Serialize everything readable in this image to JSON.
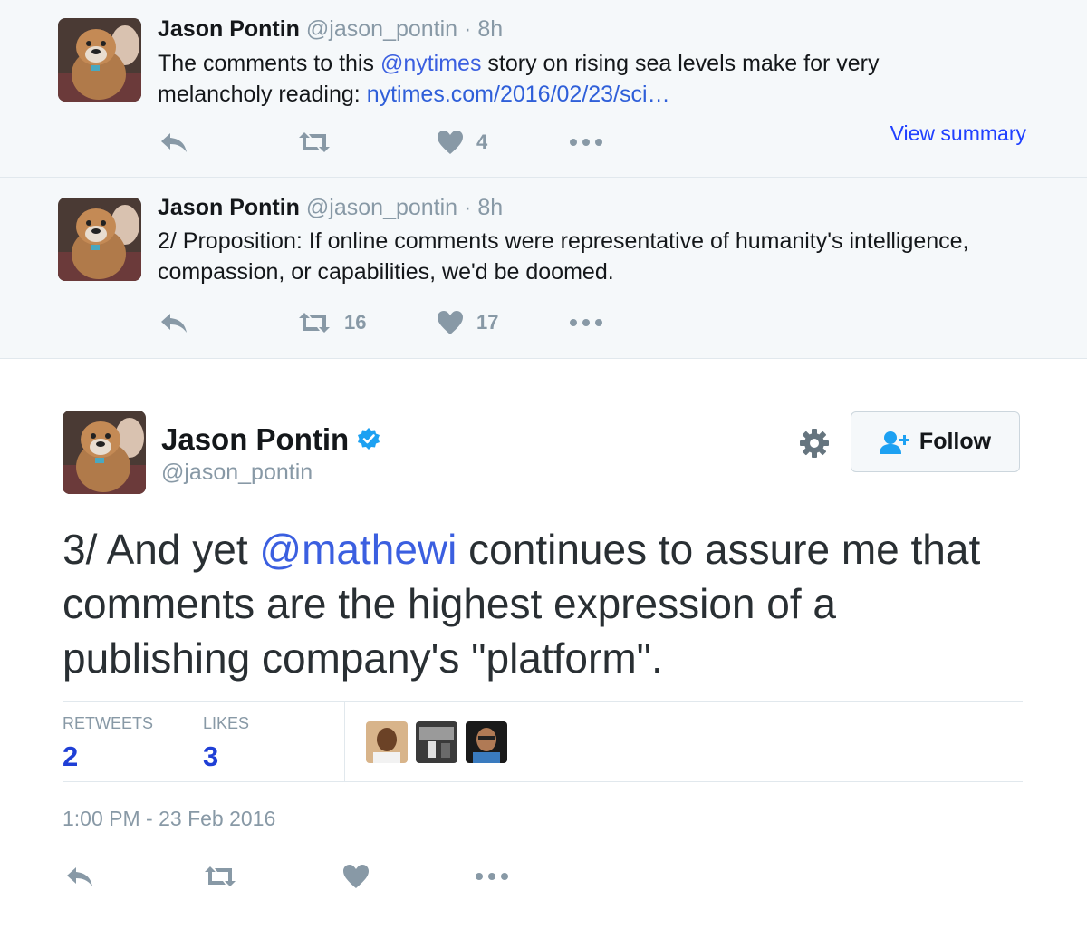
{
  "colors": {
    "name": "#14171a",
    "meta": "#8899a6",
    "link": "#2f5fd9",
    "verified": "#1da1f2",
    "stat_value": "#1f3fd6"
  },
  "tweets": [
    {
      "name": "Jason Pontin",
      "handle": "@jason_pontin",
      "dot": "·",
      "time": "8h",
      "text_parts": {
        "a": "The comments to this ",
        "mention": "@nytimes",
        "b": " story on rising sea levels make for very melancholy reading: ",
        "link": "nytimes.com/2016/02/23/sci…"
      },
      "retweets": "",
      "likes": "4",
      "view_summary": "View summary"
    },
    {
      "name": "Jason Pontin",
      "handle": "@jason_pontin",
      "dot": "·",
      "time": "8h",
      "text": "2/ Proposition: If online comments were representative of humanity's intelligence, compassion, or capabilities, we'd be doomed.",
      "retweets": "16",
      "likes": "17"
    }
  ],
  "main_tweet": {
    "name": "Jason Pontin",
    "handle": "@jason_pontin",
    "follow_label": "Follow",
    "text_parts": {
      "a": "3/ And yet ",
      "mention": "@mathewi",
      "b": " continues to assure me that comments are the highest expression of a publishing company's \"platform\"."
    },
    "stats": {
      "retweets_label": "RETWEETS",
      "retweets_value": "2",
      "likes_label": "LIKES",
      "likes_value": "3"
    },
    "timestamp": "1:00 PM - 23 Feb 2016"
  },
  "icons": [
    "reply-icon",
    "retweet-icon",
    "heart-icon",
    "more-icon",
    "gear-icon",
    "follow-icon",
    "verified-badge-icon"
  ]
}
